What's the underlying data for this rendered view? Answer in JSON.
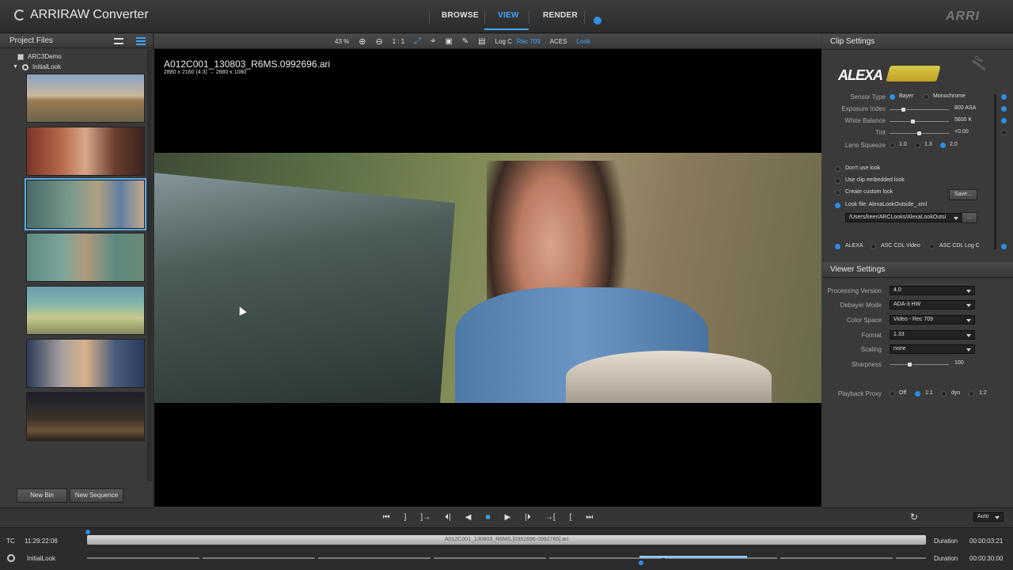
{
  "app": {
    "title": "ARRIRAW Converter",
    "brand": "ARRI"
  },
  "nav": {
    "tabs": [
      "BROWSE",
      "VIEW",
      "RENDER"
    ],
    "active": "VIEW"
  },
  "left_panel": {
    "title": "Project Files",
    "tree": [
      {
        "label": "ARC3Demo"
      },
      {
        "label": "InitialLook"
      }
    ],
    "buttons": {
      "new_bin": "New Bin",
      "new_sequence": "New Sequence"
    }
  },
  "viewer": {
    "toolbar": {
      "zoom": "43 %",
      "ratio": "1 : 1",
      "log_c": "Log C",
      "rec709": "Rec 709",
      "aces": "ACES",
      "look": "Look"
    },
    "clip_name": "A012C001_130803_R6MS.0992696.ari",
    "clip_resolution": "2880 x 2160 (4:3) → 2880 x 1080"
  },
  "clip_settings": {
    "title": "Clip Settings",
    "camera_logo": "ALEXA",
    "side_label": "CLIP\nMANUAL",
    "sensor_type": {
      "label": "Sensor Type",
      "options": [
        "Bayer",
        "Monochrome"
      ],
      "selected": "Bayer"
    },
    "exposure_index": {
      "label": "Exposure Index",
      "value": "800 ASA"
    },
    "white_balance": {
      "label": "White Balance",
      "value": "5600 K"
    },
    "tint": {
      "label": "Tint",
      "value": "+0.00"
    },
    "lens_squeeze": {
      "label": "Lens Squeeze",
      "options": [
        "1.0",
        "1.3",
        "2.0"
      ],
      "selected": "2.0"
    },
    "look_options": [
      "Don't use look",
      "Use clip embedded look",
      "Create custom look",
      "Look file: AlexaLookOutside_.xml"
    ],
    "look_selected": "Look file: AlexaLookOutside_.xml",
    "save_label": "Save...",
    "look_path": "/Users/keer/ARCLooks/AlexaLookOutsi",
    "browse_label": "...",
    "look_types": [
      "ALEXA",
      "ASC CDL Video",
      "ASC CDL Log C"
    ],
    "look_type_selected": "ALEXA"
  },
  "viewer_settings": {
    "title": "Viewer Settings",
    "processing_version": {
      "label": "Processing Version",
      "value": "4.0"
    },
    "debayer_mode": {
      "label": "Debayer Mode",
      "value": "ADA-3 HW"
    },
    "color_space": {
      "label": "Color Space",
      "value": "Video - Rec 709"
    },
    "format": {
      "label": "Format",
      "value": "1.33"
    },
    "scaling": {
      "label": "Scaling",
      "value": "none"
    },
    "sharpness": {
      "label": "Sharpness",
      "value": "100"
    },
    "playback_proxy": {
      "label": "Playback Proxy",
      "options": [
        "Off",
        "1:1",
        "dyn",
        "1:2"
      ],
      "selected": "1:1"
    }
  },
  "transport": {
    "loop_mode": "Auto"
  },
  "timeline": {
    "tc_label": "TC",
    "timecode": "11:29:22:08",
    "clip_bar": "A012C001_130803_R6MS.[0992696-0992785].ari",
    "duration_label": "Duration",
    "duration": "00:00:03:21",
    "look_label": "InitialLook",
    "look_duration": "00:00:30:00"
  }
}
